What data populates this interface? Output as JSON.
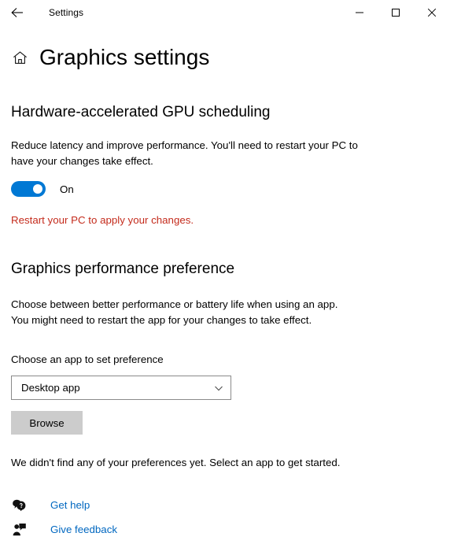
{
  "window": {
    "app_title": "Settings",
    "back_icon": "back-arrow-icon",
    "minimize_label": "Minimize",
    "maximize_label": "Maximize",
    "close_label": "Close"
  },
  "page": {
    "home_icon": "home-icon",
    "title": "Graphics settings"
  },
  "gpu_scheduling": {
    "heading": "Hardware-accelerated GPU scheduling",
    "description": "Reduce latency and improve performance. You'll need to restart your PC to have your changes take effect.",
    "toggle_state_label": "On",
    "toggle_on": true,
    "warning": "Restart your PC to apply your changes."
  },
  "graphics_preference": {
    "heading": "Graphics performance preference",
    "description": "Choose between better performance or battery life when using an app. You might need to restart the app for your changes to take effect.",
    "choose_label": "Choose an app to set preference",
    "dropdown_value": "Desktop app",
    "dropdown_icon": "chevron-down-icon",
    "browse_label": "Browse",
    "empty_state": "We didn't find any of your preferences yet. Select an app to get started."
  },
  "footer": {
    "links": [
      {
        "label": "Get help",
        "icon": "help-bubble-icon"
      },
      {
        "label": "Give feedback",
        "icon": "feedback-person-icon"
      }
    ]
  },
  "colors": {
    "accent": "#0078d4",
    "link": "#0067c0",
    "warning": "#c42b1c",
    "button": "#cccccc"
  }
}
